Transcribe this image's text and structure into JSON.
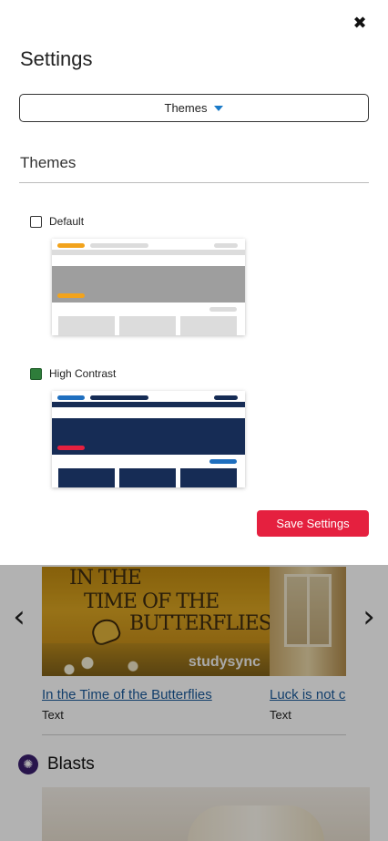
{
  "settings": {
    "title": "Settings",
    "close_glyph": "✖",
    "dropdown_label": "Themes",
    "section_title": "Themes",
    "options": [
      {
        "label": "Default",
        "checked": false
      },
      {
        "label": "High Contrast",
        "checked": true
      }
    ],
    "save_label": "Save Settings",
    "colors": {
      "accent": "#1a7ac8",
      "save_button": "#e5203f",
      "checked": "#2e7d3a",
      "default_orange": "#f2a31c",
      "contrast_navy": "#162c55",
      "contrast_blue": "#1f6fbf",
      "contrast_red": "#e5203f"
    }
  },
  "background": {
    "carousel": {
      "prev_glyph": "‹",
      "next_glyph": "›",
      "cards": [
        {
          "title": "In the Time of the Butterflies",
          "type": "Text",
          "image_text": [
            "IN THE",
            "TIME OF THE",
            "BUTTERFLIES"
          ],
          "brand": "studysync"
        },
        {
          "title": "Luck is not c",
          "type": "Text"
        }
      ]
    },
    "blasts": {
      "title": "Blasts",
      "icon": "blasts-icon"
    }
  }
}
